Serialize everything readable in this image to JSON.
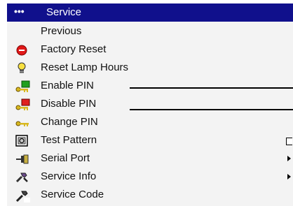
{
  "menu": {
    "title_dots": "•••",
    "title": "Service",
    "items": [
      {
        "label": "Previous",
        "icon": null
      },
      {
        "label": "Factory Reset",
        "icon": "factory-reset-icon"
      },
      {
        "label": "Reset Lamp Hours",
        "icon": "lamp-icon"
      },
      {
        "label": "Enable PIN",
        "icon": "enable-pin-key-icon"
      },
      {
        "label": "Disable PIN",
        "icon": "disable-pin-key-icon"
      },
      {
        "label": "Change PIN",
        "icon": "change-pin-key-icon"
      },
      {
        "label": "Test Pattern",
        "icon": "test-pattern-icon"
      },
      {
        "label": "Serial Port",
        "icon": "serial-port-icon"
      },
      {
        "label": "Service Info",
        "icon": "service-info-icon"
      },
      {
        "label": "Service Code",
        "icon": "service-code-icon"
      }
    ]
  },
  "colors": {
    "title_bar": "#10108c",
    "menu_background": "#f3f3f3",
    "text": "#111111"
  }
}
